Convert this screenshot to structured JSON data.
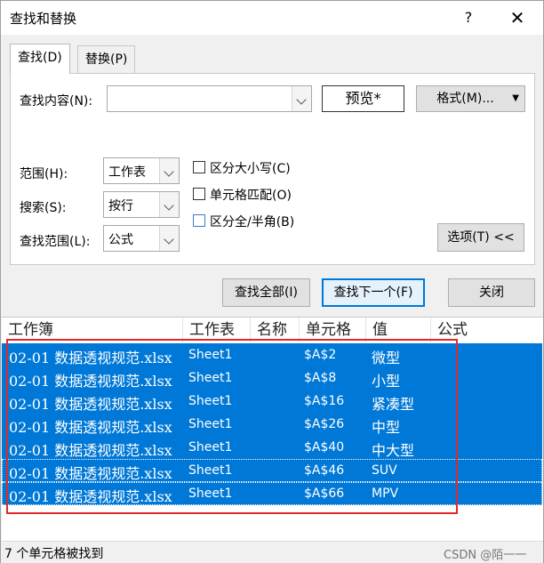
{
  "title": "查找和替换",
  "help": "?",
  "close": "✕",
  "tabs": [
    {
      "label": "查找(D)"
    },
    {
      "label": "替换(P)"
    }
  ],
  "find": {
    "label": "查找内容(N):",
    "value": "",
    "preview_label": "预览*",
    "format_label": "格式(M)..."
  },
  "options": {
    "scope_label": "范围(H):",
    "scope_value": "工作表",
    "search_label": "搜索(S):",
    "search_value": "按行",
    "lookin_label": "查找范围(L):",
    "lookin_value": "公式",
    "match_case": "区分大小写(C)",
    "match_cell": "单元格匹配(O)",
    "match_width": "区分全/半角(B)",
    "options_button": "选项(T) <<"
  },
  "actions": {
    "find_all": "查找全部(I)",
    "find_next": "查找下一个(F)",
    "close": "关闭"
  },
  "results": {
    "columns": [
      "工作簿",
      "工作表",
      "名称",
      "单元格",
      "值",
      "公式"
    ],
    "rows": [
      {
        "book": "02-01 数据透视规范.xlsx",
        "sheet": "Sheet1",
        "name": "",
        "cell": "$A$2",
        "value": "微型",
        "formula": ""
      },
      {
        "book": "02-01 数据透视规范.xlsx",
        "sheet": "Sheet1",
        "name": "",
        "cell": "$A$8",
        "value": "小型",
        "formula": ""
      },
      {
        "book": "02-01 数据透视规范.xlsx",
        "sheet": "Sheet1",
        "name": "",
        "cell": "$A$16",
        "value": "紧凑型",
        "formula": ""
      },
      {
        "book": "02-01 数据透视规范.xlsx",
        "sheet": "Sheet1",
        "name": "",
        "cell": "$A$26",
        "value": "中型",
        "formula": ""
      },
      {
        "book": "02-01 数据透视规范.xlsx",
        "sheet": "Sheet1",
        "name": "",
        "cell": "$A$40",
        "value": "中大型",
        "formula": ""
      },
      {
        "book": "02-01 数据透视规范.xlsx",
        "sheet": "Sheet1",
        "name": "",
        "cell": "$A$46",
        "value": "SUV",
        "formula": ""
      },
      {
        "book": "02-01 数据透视规范.xlsx",
        "sheet": "Sheet1",
        "name": "",
        "cell": "$A$66",
        "value": "MPV",
        "formula": ""
      }
    ]
  },
  "status": "7 个单元格被找到",
  "watermark": "CSDN @陌一一",
  "colors": {
    "selection": "#0078d7",
    "highlight_box": "#e02a2a"
  }
}
